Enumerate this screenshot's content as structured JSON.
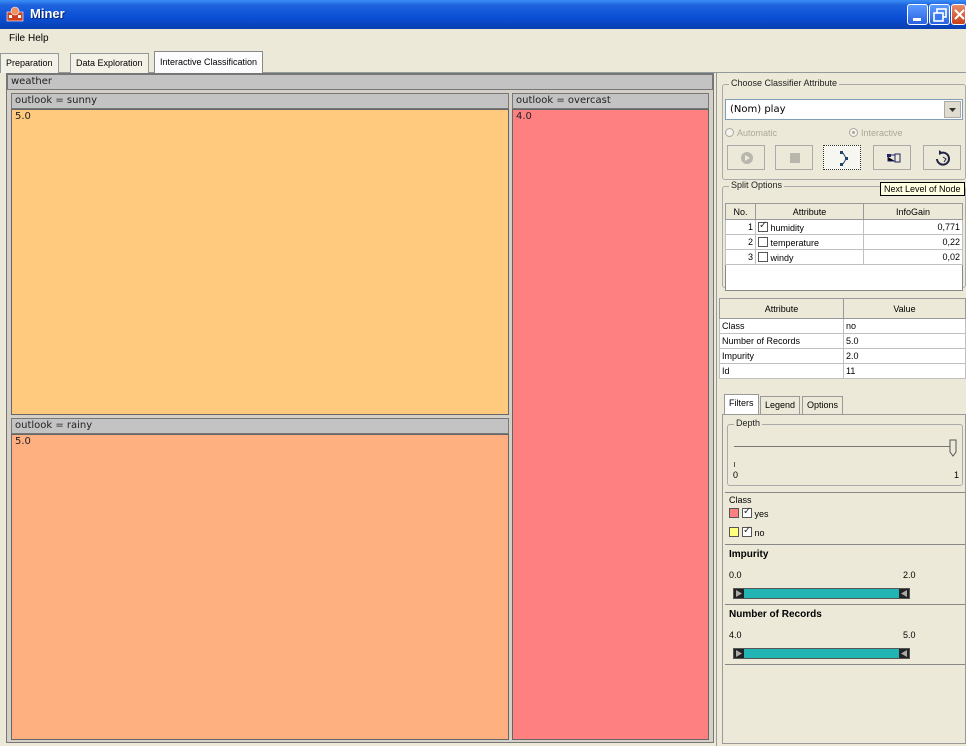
{
  "window": {
    "title": "Miner"
  },
  "menu": {
    "file": "File",
    "help": "Help"
  },
  "tabs": [
    {
      "label": "Preparation"
    },
    {
      "label": "Data Exploration"
    },
    {
      "label": "Interactive Classification",
      "active": true
    }
  ],
  "tree": {
    "root": "weather",
    "sunny": {
      "header": "outlook = sunny",
      "value": "5.0",
      "color": "#ffc97e"
    },
    "overcast": {
      "header": "outlook = overcast",
      "value": "4.0",
      "color": "#ff8080"
    },
    "rainy": {
      "header": "outlook = rainy",
      "value": "5.0",
      "color": "#ffb080"
    }
  },
  "classifier": {
    "group_title": "Choose Classifier Attribute",
    "selected": "(Nom) play",
    "automatic": "Automatic",
    "interactive": "Interactive",
    "mode": "interactive"
  },
  "split": {
    "group_title": "Split Options",
    "tooltip": "Next Level of Node",
    "headers": [
      "No.",
      "Attribute",
      "InfoGain"
    ],
    "rows": [
      {
        "no": "1",
        "attr": "humidity",
        "gain": "0,771",
        "checked": true
      },
      {
        "no": "2",
        "attr": "temperature",
        "gain": "0,22",
        "checked": false
      },
      {
        "no": "3",
        "attr": "windy",
        "gain": "0,02",
        "checked": false
      }
    ]
  },
  "node_info": {
    "headers": [
      "Attribute",
      "Value"
    ],
    "rows": [
      {
        "attr": "Class",
        "value": "no"
      },
      {
        "attr": "Number of Records",
        "value": "5.0"
      },
      {
        "attr": "Impurity",
        "value": "2.0"
      },
      {
        "attr": "Id",
        "value": "11"
      }
    ]
  },
  "filters": {
    "tabs": [
      "Filters",
      "Legend",
      "Options"
    ],
    "depth": {
      "title": "Depth",
      "min": "0",
      "max": "1",
      "level": 1
    },
    "class": {
      "title": "Class",
      "items": [
        {
          "label": "yes",
          "color": "#ff8080",
          "checked": true
        },
        {
          "label": "no",
          "color": "#ffff80",
          "checked": true
        }
      ]
    },
    "impurity": {
      "title": "Impurity",
      "min": "0.0",
      "max": "2.0"
    },
    "records": {
      "title": "Number of Records",
      "min": "4.0",
      "max": "5.0"
    }
  }
}
